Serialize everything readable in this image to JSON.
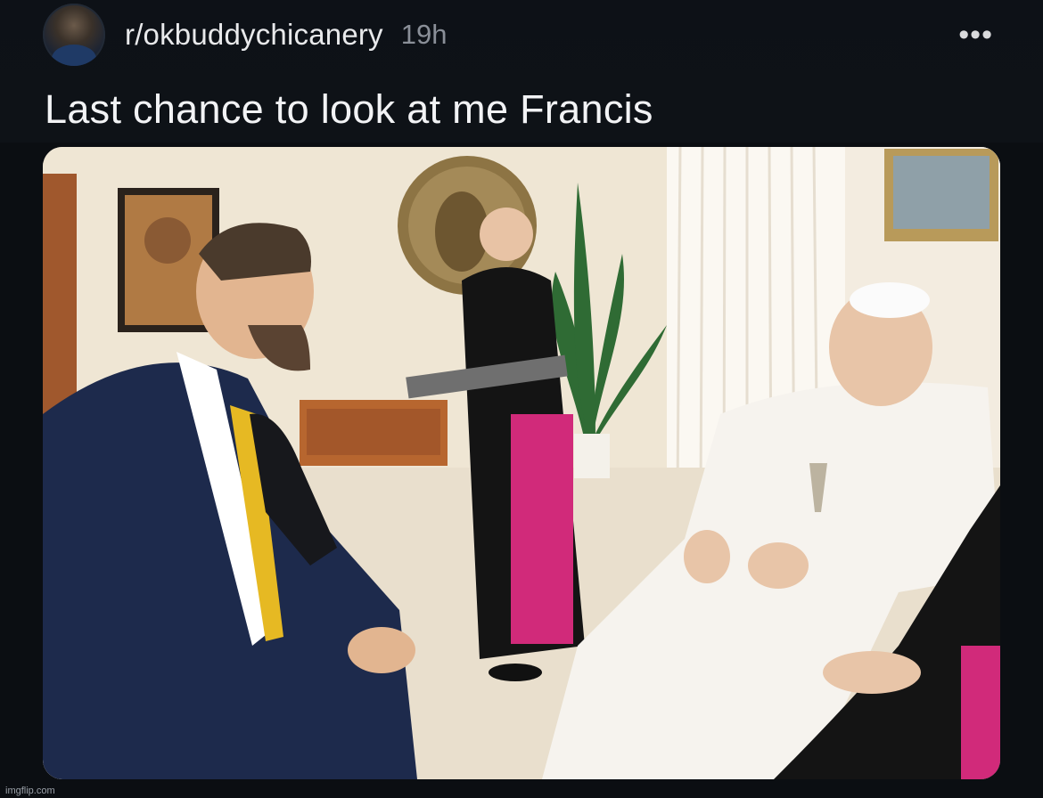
{
  "post": {
    "subreddit": "r/okbuddychicanery",
    "age": "19h",
    "more_label": "•••",
    "title": "Last chance to look at me Francis"
  },
  "media": {
    "alt": "Photo of a meeting in a room with a seated man in a white cassock, a man in a dark suit and yellow tie, and a standing cleric holding a folder"
  },
  "watermark": "imgflip.com",
  "colors": {
    "background": "#0b0e12",
    "text_primary": "#f2f3f5",
    "text_secondary": "#8a8f98"
  }
}
